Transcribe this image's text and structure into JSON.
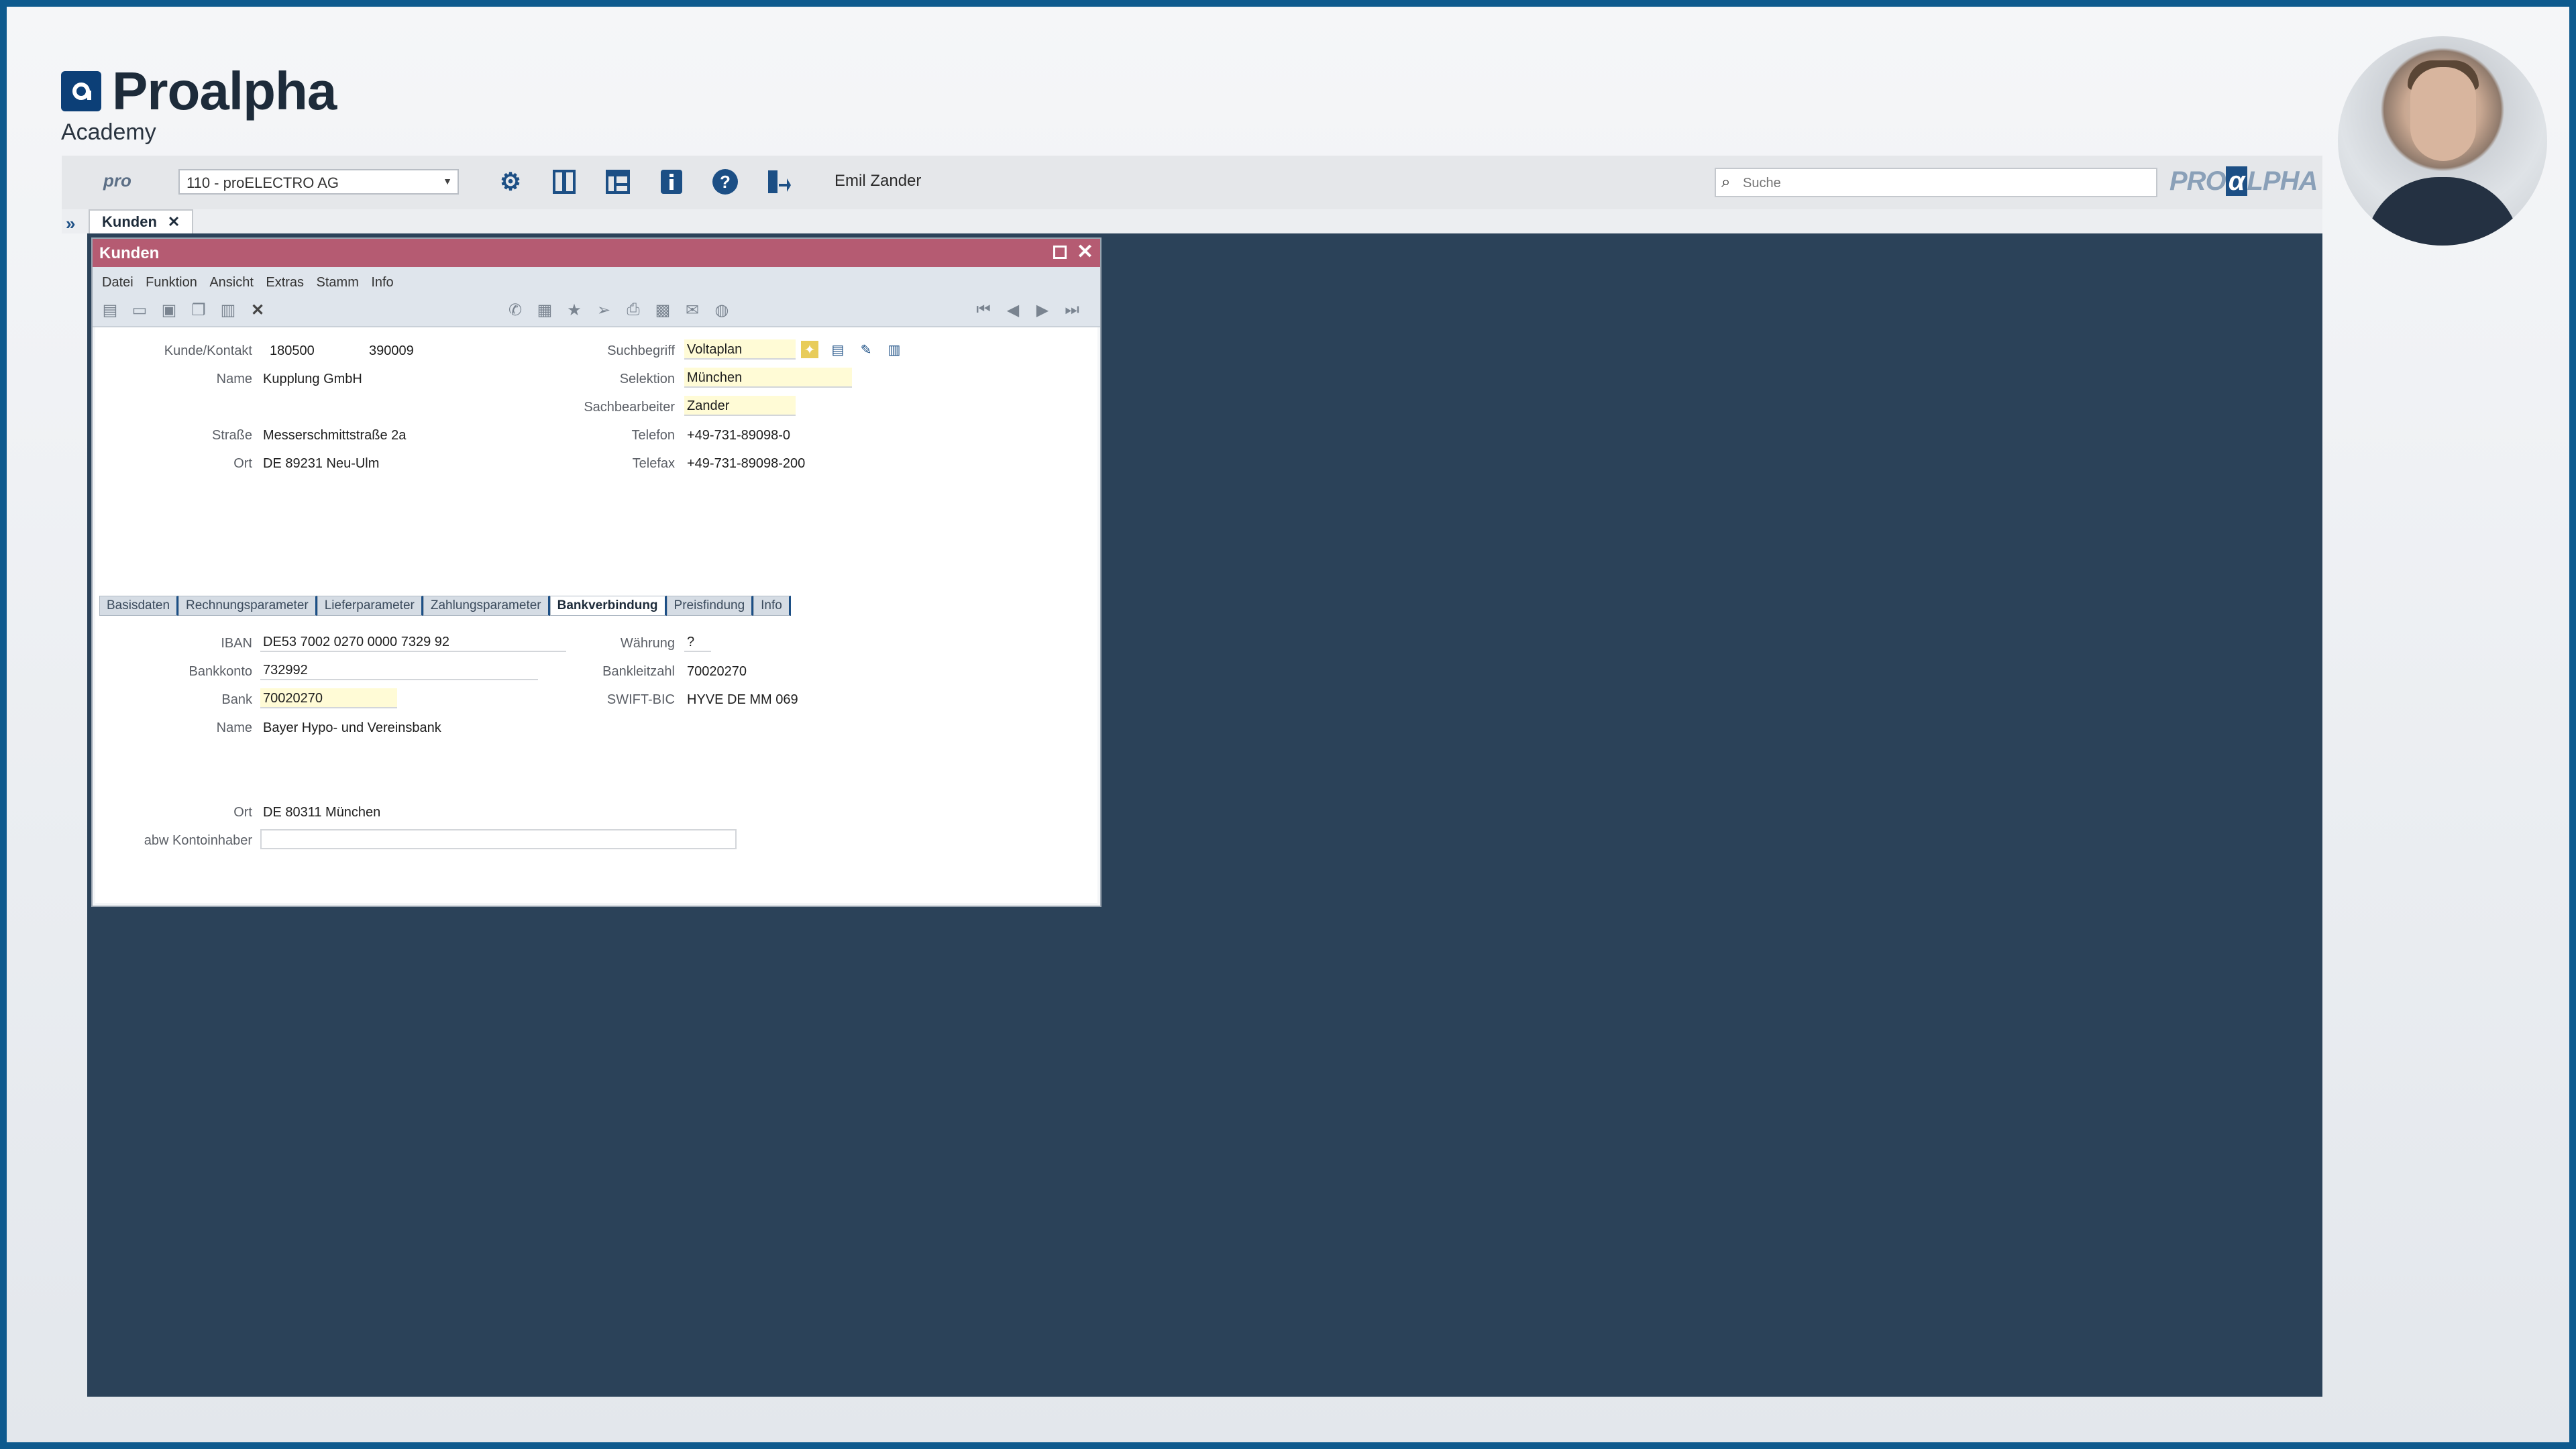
{
  "brand": {
    "name": "Proalpha",
    "sub": "Academy"
  },
  "toolbar": {
    "pro_logo": "pro",
    "company": "110 - proELECTRO AG",
    "user": "Emil Zander",
    "search_placeholder": "Suche",
    "wordmark_left": "PRO",
    "wordmark_a": "α",
    "wordmark_right": "LPHA"
  },
  "doc_tab": {
    "label": "Kunden",
    "close": "✕"
  },
  "window": {
    "title": "Kunden",
    "menu": [
      "Datei",
      "Funktion",
      "Ansicht",
      "Extras",
      "Stamm",
      "Info"
    ]
  },
  "form": {
    "kunde_kontakt_label": "Kunde/Kontakt",
    "kunde": "180500",
    "kontakt": "390009",
    "name_label": "Name",
    "name": "Kupplung GmbH",
    "strasse_label": "Straße",
    "strasse": "Messerschmittstraße 2a",
    "ort_label": "Ort",
    "ort": "DE 89231 Neu-Ulm",
    "suchbegriff_label": "Suchbegriff",
    "suchbegriff": "Voltaplan",
    "selektion_label": "Selektion",
    "selektion": "München",
    "sachbearbeiter_label": "Sachbearbeiter",
    "sachbearbeiter": "Zander",
    "telefon_label": "Telefon",
    "telefon": "+49-731-89098-0",
    "telefax_label": "Telefax",
    "telefax": "+49-731-89098-200"
  },
  "tabs": [
    "Basisdaten",
    "Rechnungsparameter",
    "Lieferparameter",
    "Zahlungsparameter",
    "Bankverbindung",
    "Preisfindung",
    "Info"
  ],
  "bank": {
    "iban_label": "IBAN",
    "iban": "DE53 7002 0270 0000 7329 92",
    "bankkonto_label": "Bankkonto",
    "bankkonto": "732992",
    "bank_label": "Bank",
    "bank": "70020270",
    "name_label": "Name",
    "name": "Bayer Hypo- und Vereinsbank",
    "ort_label": "Ort",
    "ort": "DE 80311 München",
    "abw_label": "abw Kontoinhaber",
    "abw": "",
    "waehrung_label": "Währung",
    "waehrung": "?",
    "blz_label": "Bankleitzahl",
    "blz": "70020270",
    "swift_label": "SWIFT-BIC",
    "swift": "HYVE DE MM 069"
  },
  "icons": {
    "settings": "gear-icon",
    "panel": "panel-icon",
    "layout": "layout-icon",
    "info": "info-icon",
    "help": "help-icon",
    "exit": "exit-icon"
  }
}
